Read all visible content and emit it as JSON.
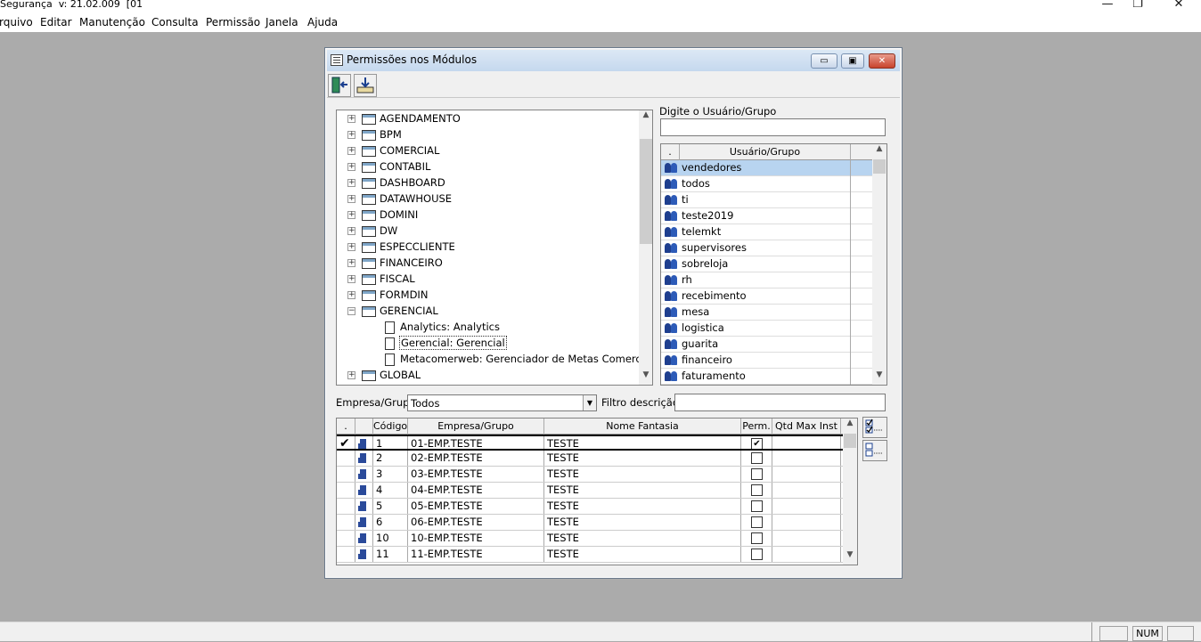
{
  "app": {
    "title": "Segurança  v: 21.02.009  [01",
    "win_controls": [
      "—",
      "❐",
      "✕"
    ],
    "menu": [
      "rquivo",
      "Editar",
      "Manutenção",
      "Consulta",
      "Permissão",
      "Janela",
      "Ajuda"
    ],
    "status": {
      "num": "NUM"
    }
  },
  "dialog": {
    "title": "Permissões nos Módulos",
    "caption_buttons": [
      "▭",
      "▣",
      "✕"
    ]
  },
  "tree": {
    "modules": [
      {
        "label": "AGENDAMENTO",
        "expander": "+"
      },
      {
        "label": "BPM",
        "expander": "+"
      },
      {
        "label": "COMERCIAL",
        "expander": "+"
      },
      {
        "label": "CONTABIL",
        "expander": "+"
      },
      {
        "label": "DASHBOARD",
        "expander": "+"
      },
      {
        "label": "DATAWHOUSE",
        "expander": "+"
      },
      {
        "label": "DOMINI",
        "expander": "+"
      },
      {
        "label": "DW",
        "expander": "+"
      },
      {
        "label": "ESPECCLIENTE",
        "expander": "+"
      },
      {
        "label": "FINANCEIRO",
        "expander": "+"
      },
      {
        "label": "FISCAL",
        "expander": "+"
      },
      {
        "label": "FORMDIN",
        "expander": "+"
      },
      {
        "label": "GERENCIAL",
        "expander": "−"
      }
    ],
    "children": [
      {
        "label": "Analytics: Analytics"
      },
      {
        "label": "Gerencial: Gerencial",
        "selected": true
      },
      {
        "label": "Metacomerweb: Gerenciador de Metas Comerciais"
      }
    ],
    "after": {
      "label": "GLOBAL",
      "expander": "+"
    }
  },
  "user_search": {
    "label": "Digite o Usuário/Grupo",
    "value": ""
  },
  "user_grid": {
    "columns": [
      ".",
      "Usuário/Grupo"
    ],
    "rows": [
      "vendedores",
      "todos",
      "ti",
      "teste2019",
      "telemkt",
      "supervisores",
      "sobreloja",
      "rh",
      "recebimento",
      "mesa",
      "logistica",
      "guarita",
      "financeiro",
      "faturamento"
    ],
    "selected_row": 0,
    "selected_color": "#b8d4f0"
  },
  "filters": {
    "empresa_label": "Empresa/Grupo:",
    "empresa_value": "Todos",
    "filtro_label": "Filtro descrição:",
    "filtro_value": ""
  },
  "company_grid": {
    "columns": [
      ".",
      "Código",
      "Empresa/Grupo",
      "Nome Fantasia",
      "Perm.",
      "Qtd Max Inst"
    ],
    "rows": [
      {
        "codigo": "1",
        "empresa": "01-EMP.TESTE",
        "fantasia": "TESTE",
        "perm": true
      },
      {
        "codigo": "2",
        "empresa": "02-EMP.TESTE",
        "fantasia": "TESTE",
        "perm": false
      },
      {
        "codigo": "3",
        "empresa": "03-EMP.TESTE",
        "fantasia": "TESTE",
        "perm": false
      },
      {
        "codigo": "4",
        "empresa": "04-EMP.TESTE",
        "fantasia": "TESTE",
        "perm": false
      },
      {
        "codigo": "5",
        "empresa": "05-EMP.TESTE",
        "fantasia": "TESTE",
        "perm": false
      },
      {
        "codigo": "6",
        "empresa": "06-EMP.TESTE",
        "fantasia": "TESTE",
        "perm": false
      },
      {
        "codigo": "10",
        "empresa": "10-EMP.TESTE",
        "fantasia": "TESTE",
        "perm": false
      },
      {
        "codigo": "11",
        "empresa": "11-EMP.TESTE",
        "fantasia": "TESTE",
        "perm": false
      }
    ],
    "current_row_marker": "✔"
  }
}
